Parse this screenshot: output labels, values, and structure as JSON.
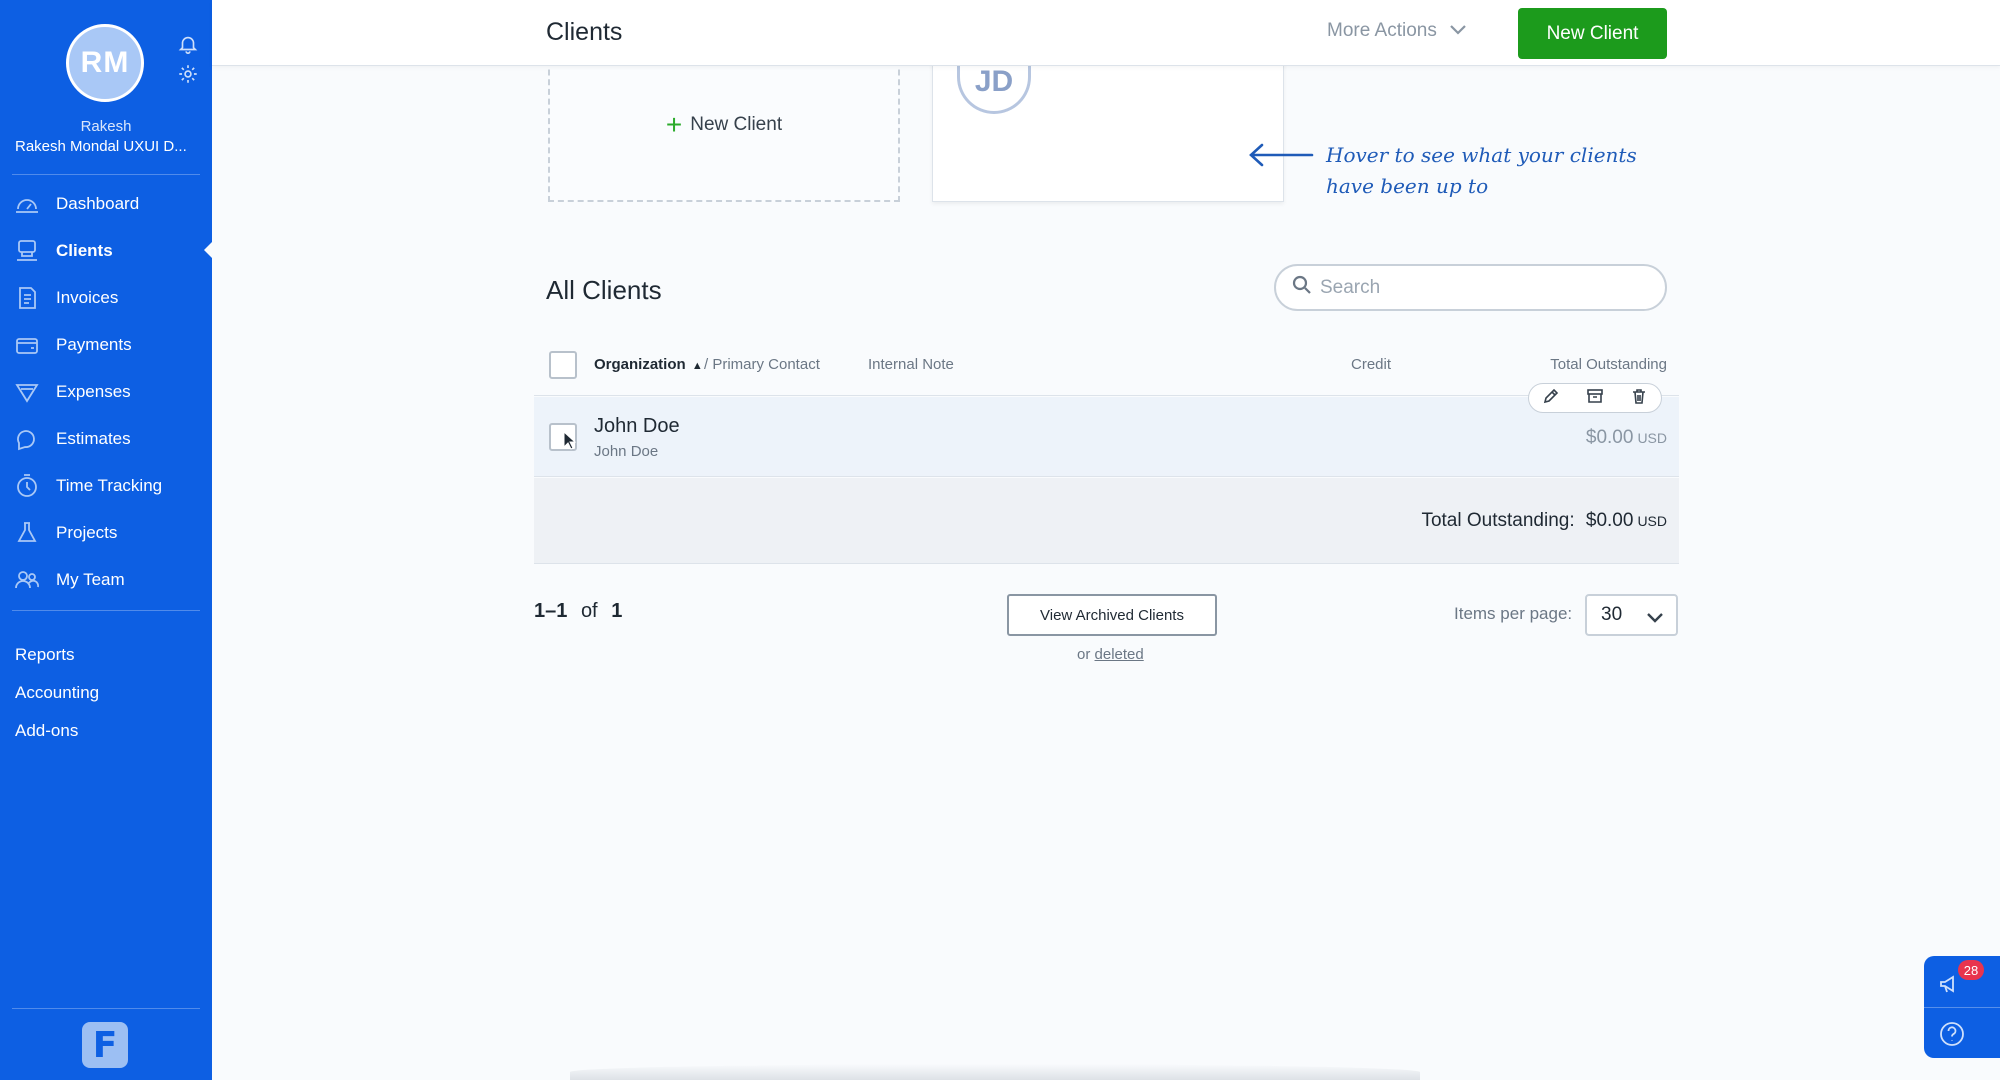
{
  "sidebar": {
    "avatar_initials": "RM",
    "user_first_name": "Rakesh",
    "user_company": "Rakesh Mondal UXUI D...",
    "nav": [
      {
        "label": "Dashboard",
        "icon": "dashboard-icon"
      },
      {
        "label": "Clients",
        "icon": "clients-icon",
        "active": true
      },
      {
        "label": "Invoices",
        "icon": "invoices-icon"
      },
      {
        "label": "Payments",
        "icon": "payments-icon"
      },
      {
        "label": "Expenses",
        "icon": "expenses-icon"
      },
      {
        "label": "Estimates",
        "icon": "estimates-icon"
      },
      {
        "label": "Time Tracking",
        "icon": "time-tracking-icon"
      },
      {
        "label": "Projects",
        "icon": "projects-icon"
      },
      {
        "label": "My Team",
        "icon": "team-icon"
      }
    ],
    "extra": [
      "Reports",
      "Accounting",
      "Add-ons"
    ],
    "logo_letter": "F"
  },
  "header": {
    "title": "Clients",
    "more_actions": "More Actions",
    "new_client": "New Client"
  },
  "cards": {
    "new_client_label": "New Client",
    "client_initials": "JD",
    "hint": "Hover to see what your clients have been up to"
  },
  "clients": {
    "section_title": "All Clients",
    "search_placeholder": "Search",
    "columns": {
      "organization": "Organization",
      "primary_contact": "/ Primary Contact",
      "internal_note": "Internal Note",
      "credit": "Credit",
      "total_outstanding": "Total Outstanding"
    },
    "rows": [
      {
        "organization": "John Doe",
        "contact": "John Doe",
        "amount": "$0.00",
        "currency": "USD"
      }
    ],
    "total_label": "Total Outstanding:",
    "total_amount": "$0.00",
    "total_currency": "USD"
  },
  "pagination": {
    "range": "1–1",
    "of": "of",
    "total": "1",
    "view_archived": "View Archived Clients",
    "or": "or",
    "deleted": "deleted",
    "items_per_page_label": "Items per page:",
    "items_per_page": "30"
  },
  "help_widget": {
    "notification_count": "28"
  },
  "colors": {
    "sidebar": "#0d5fe3",
    "primary_button": "#1c9b1c",
    "badge": "#e8344e"
  }
}
